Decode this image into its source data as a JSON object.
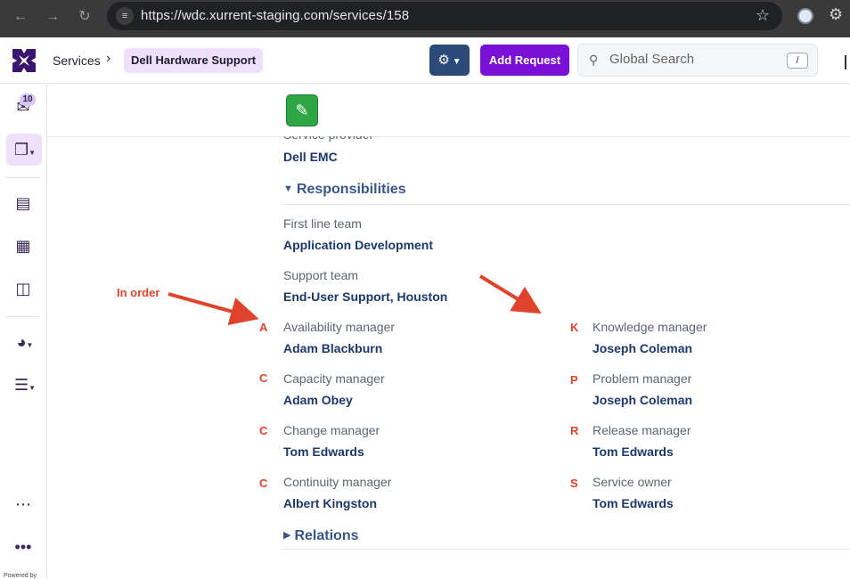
{
  "browser": {
    "url": "https://wdc.xurrent-staging.com/services/158"
  },
  "header": {
    "breadcrumb_root": "Services",
    "breadcrumb_current": "Dell Hardware Support",
    "add_request_label": "Add Request",
    "search_placeholder": "Global Search",
    "search_shortcut": "/"
  },
  "sidebar": {
    "inbox_count": "10",
    "powered_by": "Powered by"
  },
  "content": {
    "service_provider_label": "Service provider",
    "service_provider_value": "Dell EMC",
    "responsibilities_title": "Responsibilities",
    "relations_title": "Relations",
    "first_line_team": {
      "label": "First line team",
      "value": "Application Development"
    },
    "support_team": {
      "label": "Support team",
      "value": "End-User Support, Houston"
    },
    "left_fields": [
      {
        "label": "Availability manager",
        "value": "Adam Blackburn"
      },
      {
        "label": "Capacity manager",
        "value": "Adam Obey"
      },
      {
        "label": "Change manager",
        "value": "Tom Edwards"
      },
      {
        "label": "Continuity manager",
        "value": "Albert Kingston"
      }
    ],
    "right_fields": [
      {
        "label": "Knowledge manager",
        "value": "Joseph Coleman"
      },
      {
        "label": "Problem manager",
        "value": "Joseph Coleman"
      },
      {
        "label": "Release manager",
        "value": "Tom Edwards"
      },
      {
        "label": "Service owner",
        "value": "Tom Edwards"
      }
    ]
  },
  "annotations": {
    "note": "In order",
    "left_letters": [
      "A",
      "C",
      "C",
      "C"
    ],
    "right_letters": [
      "K",
      "P",
      "R",
      "S"
    ],
    "color": "#e0432b"
  },
  "colors": {
    "brand_purple": "#7a10d6",
    "settings_blue": "#2b4a7a",
    "edit_green": "#2fa646",
    "value_navy": "#1d3869"
  }
}
